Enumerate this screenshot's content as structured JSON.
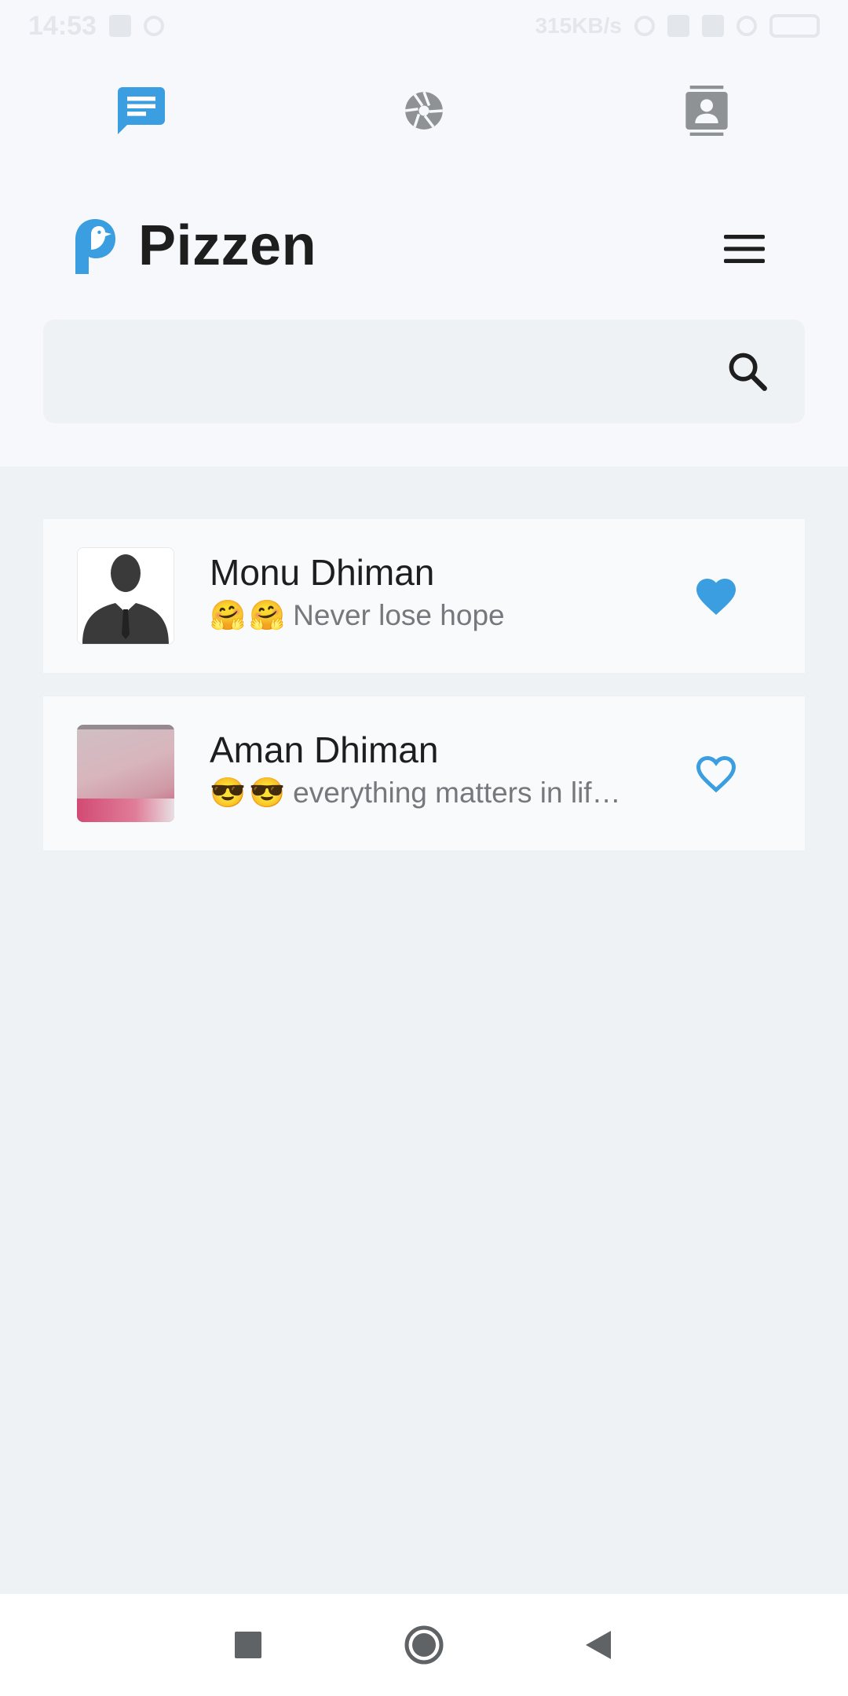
{
  "status_bar": {
    "time": "14:53",
    "network_speed": "315KB/s"
  },
  "tabs": [
    {
      "name": "chats",
      "icon": "chat-icon",
      "active": true
    },
    {
      "name": "status",
      "icon": "camera-aperture-icon",
      "active": false
    },
    {
      "name": "contacts",
      "icon": "contact-card-icon",
      "active": false
    }
  ],
  "app": {
    "name": "Pizzen",
    "logo": "pizzen-bird-logo",
    "menu_icon": "hamburger-menu-icon"
  },
  "search": {
    "value": "",
    "placeholder": "",
    "icon": "search-icon"
  },
  "contacts": [
    {
      "name": "Monu Dhiman",
      "emoji": [
        "🤗",
        "🤗"
      ],
      "status": "Never lose hope",
      "favorite": true,
      "avatar": "silhouette-avatar"
    },
    {
      "name": "Aman Dhiman",
      "emoji": [
        "😎",
        "😎"
      ],
      "status": "everything matters in lif…",
      "favorite": false,
      "avatar": "blurred-photo-avatar"
    }
  ],
  "nav": {
    "recents_icon": "square-icon",
    "home_icon": "circle-icon",
    "back_icon": "triangle-back-icon"
  },
  "colors": {
    "accent": "#3a9ee0",
    "background": "#eff2f4",
    "header": "#f7f8fb",
    "card": "#f9fafc",
    "text_primary": "#1e1e1e",
    "text_secondary": "#75787c",
    "icon_gray": "#8f9294"
  }
}
